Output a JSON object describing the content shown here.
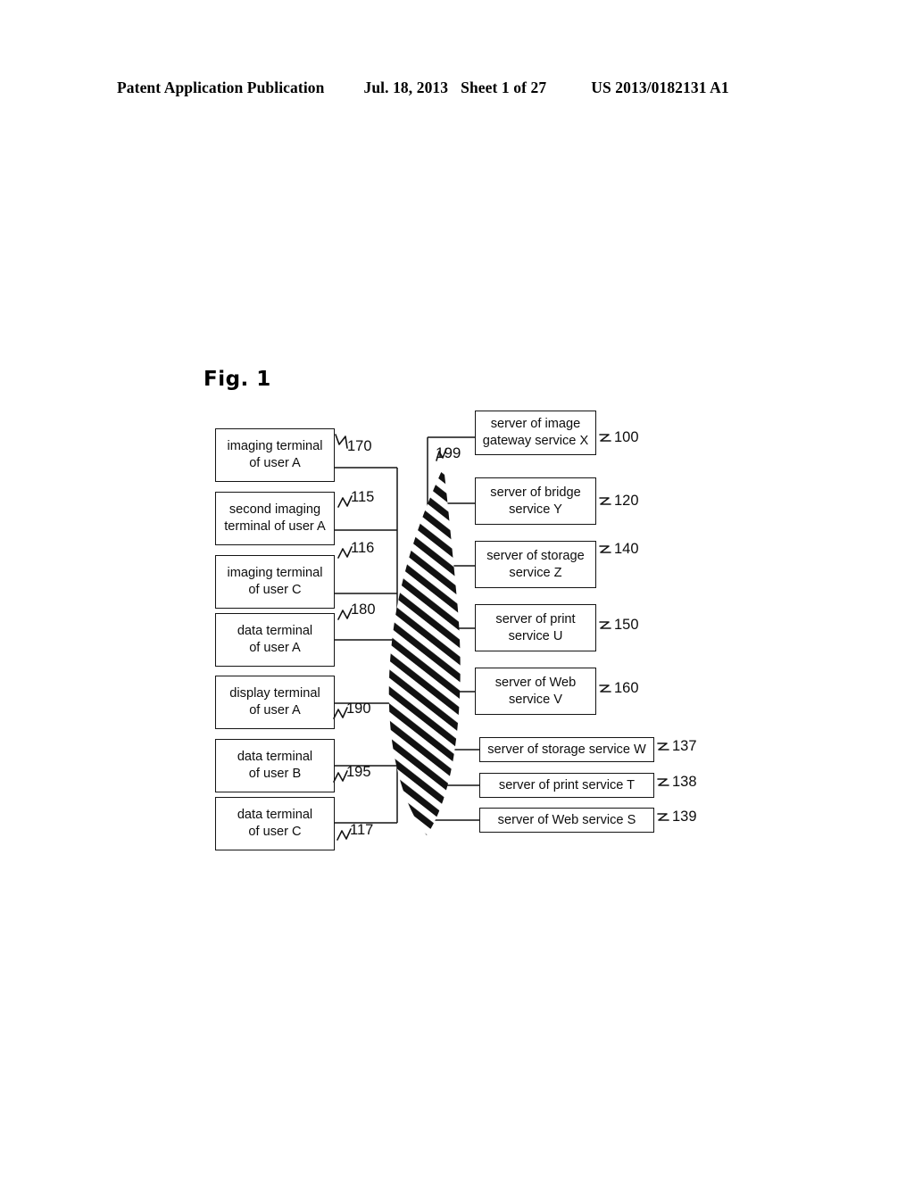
{
  "header": {
    "publication": "Patent Application Publication",
    "date": "Jul. 18, 2013",
    "sheet": "Sheet 1 of 27",
    "patent_number": "US 2013/0182131 A1"
  },
  "figure": {
    "title": "Fig. 1",
    "network_label": "199",
    "left_nodes": [
      {
        "ref": "170",
        "line1": "imaging terminal",
        "line2": "of user A"
      },
      {
        "ref": "115",
        "line1": "second imaging",
        "line2": "terminal of user A"
      },
      {
        "ref": "116",
        "line1": "imaging terminal",
        "line2": "of user C"
      },
      {
        "ref": "180",
        "line1": "data terminal",
        "line2": "of user A"
      },
      {
        "ref": "190",
        "line1": "display terminal",
        "line2": "of user A"
      },
      {
        "ref": "195",
        "line1": "data terminal",
        "line2": "of user B"
      },
      {
        "ref": "117",
        "line1": "data terminal",
        "line2": "of user C"
      }
    ],
    "right_nodes": [
      {
        "ref": "100",
        "line1": "server of image",
        "line2": "gateway service X"
      },
      {
        "ref": "120",
        "line1": "server of bridge",
        "line2": "service Y"
      },
      {
        "ref": "140",
        "line1": "server of storage",
        "line2": "service Z"
      },
      {
        "ref": "150",
        "line1": "server of print",
        "line2": "service U"
      },
      {
        "ref": "160",
        "line1": "server of Web",
        "line2": "service V"
      },
      {
        "ref": "137",
        "line1": "server of storage service W",
        "line2": ""
      },
      {
        "ref": "138",
        "line1": "server of print service T",
        "line2": ""
      },
      {
        "ref": "139",
        "line1": "server of Web service S",
        "line2": ""
      }
    ]
  }
}
